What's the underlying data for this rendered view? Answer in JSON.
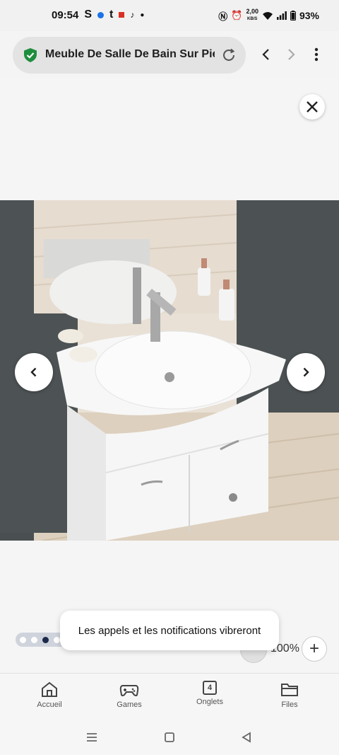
{
  "status_bar": {
    "time": "09:54",
    "left_glyphs": [
      "S",
      "t"
    ],
    "data_speed_value": "2,00",
    "data_speed_unit": "KB/S",
    "battery": "93%",
    "colors": {
      "shield": "#1e8e3e",
      "accent_dot": "#1a73e8",
      "red": "#d93025"
    }
  },
  "browser": {
    "url_title": "Meuble De Salle De Bain Sur Pie...",
    "icons": [
      "shield-check-icon",
      "reload-icon",
      "back-icon",
      "forward-icon",
      "more-vert-icon"
    ]
  },
  "viewer": {
    "image_alt": "Meuble de salle de bain blanc avec vasque",
    "slide_index": 3,
    "slide_count": 4,
    "zoom_label": "100%",
    "zoom_plus": "+"
  },
  "toast": {
    "message": "Les appels et les notifications vibreront"
  },
  "bottom_nav": {
    "items": [
      {
        "label": "Accueil",
        "icon": "home-icon"
      },
      {
        "label": "Games",
        "icon": "gamepad-icon"
      },
      {
        "label": "Onglets",
        "icon": "tabs-icon",
        "count": "4"
      },
      {
        "label": "Files",
        "icon": "folder-icon"
      }
    ]
  }
}
